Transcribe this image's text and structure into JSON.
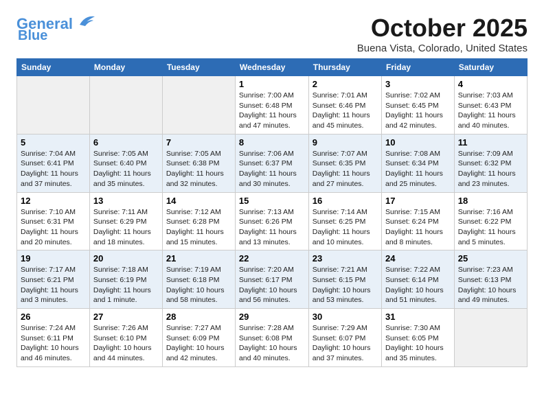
{
  "header": {
    "logo_line1": "General",
    "logo_line2": "Blue",
    "month": "October 2025",
    "location": "Buena Vista, Colorado, United States"
  },
  "weekdays": [
    "Sunday",
    "Monday",
    "Tuesday",
    "Wednesday",
    "Thursday",
    "Friday",
    "Saturday"
  ],
  "weeks": [
    [
      {
        "num": "",
        "info": ""
      },
      {
        "num": "",
        "info": ""
      },
      {
        "num": "",
        "info": ""
      },
      {
        "num": "1",
        "info": "Sunrise: 7:00 AM\nSunset: 6:48 PM\nDaylight: 11 hours\nand 47 minutes."
      },
      {
        "num": "2",
        "info": "Sunrise: 7:01 AM\nSunset: 6:46 PM\nDaylight: 11 hours\nand 45 minutes."
      },
      {
        "num": "3",
        "info": "Sunrise: 7:02 AM\nSunset: 6:45 PM\nDaylight: 11 hours\nand 42 minutes."
      },
      {
        "num": "4",
        "info": "Sunrise: 7:03 AM\nSunset: 6:43 PM\nDaylight: 11 hours\nand 40 minutes."
      }
    ],
    [
      {
        "num": "5",
        "info": "Sunrise: 7:04 AM\nSunset: 6:41 PM\nDaylight: 11 hours\nand 37 minutes."
      },
      {
        "num": "6",
        "info": "Sunrise: 7:05 AM\nSunset: 6:40 PM\nDaylight: 11 hours\nand 35 minutes."
      },
      {
        "num": "7",
        "info": "Sunrise: 7:05 AM\nSunset: 6:38 PM\nDaylight: 11 hours\nand 32 minutes."
      },
      {
        "num": "8",
        "info": "Sunrise: 7:06 AM\nSunset: 6:37 PM\nDaylight: 11 hours\nand 30 minutes."
      },
      {
        "num": "9",
        "info": "Sunrise: 7:07 AM\nSunset: 6:35 PM\nDaylight: 11 hours\nand 27 minutes."
      },
      {
        "num": "10",
        "info": "Sunrise: 7:08 AM\nSunset: 6:34 PM\nDaylight: 11 hours\nand 25 minutes."
      },
      {
        "num": "11",
        "info": "Sunrise: 7:09 AM\nSunset: 6:32 PM\nDaylight: 11 hours\nand 23 minutes."
      }
    ],
    [
      {
        "num": "12",
        "info": "Sunrise: 7:10 AM\nSunset: 6:31 PM\nDaylight: 11 hours\nand 20 minutes."
      },
      {
        "num": "13",
        "info": "Sunrise: 7:11 AM\nSunset: 6:29 PM\nDaylight: 11 hours\nand 18 minutes."
      },
      {
        "num": "14",
        "info": "Sunrise: 7:12 AM\nSunset: 6:28 PM\nDaylight: 11 hours\nand 15 minutes."
      },
      {
        "num": "15",
        "info": "Sunrise: 7:13 AM\nSunset: 6:26 PM\nDaylight: 11 hours\nand 13 minutes."
      },
      {
        "num": "16",
        "info": "Sunrise: 7:14 AM\nSunset: 6:25 PM\nDaylight: 11 hours\nand 10 minutes."
      },
      {
        "num": "17",
        "info": "Sunrise: 7:15 AM\nSunset: 6:24 PM\nDaylight: 11 hours\nand 8 minutes."
      },
      {
        "num": "18",
        "info": "Sunrise: 7:16 AM\nSunset: 6:22 PM\nDaylight: 11 hours\nand 5 minutes."
      }
    ],
    [
      {
        "num": "19",
        "info": "Sunrise: 7:17 AM\nSunset: 6:21 PM\nDaylight: 11 hours\nand 3 minutes."
      },
      {
        "num": "20",
        "info": "Sunrise: 7:18 AM\nSunset: 6:19 PM\nDaylight: 11 hours\nand 1 minute."
      },
      {
        "num": "21",
        "info": "Sunrise: 7:19 AM\nSunset: 6:18 PM\nDaylight: 10 hours\nand 58 minutes."
      },
      {
        "num": "22",
        "info": "Sunrise: 7:20 AM\nSunset: 6:17 PM\nDaylight: 10 hours\nand 56 minutes."
      },
      {
        "num": "23",
        "info": "Sunrise: 7:21 AM\nSunset: 6:15 PM\nDaylight: 10 hours\nand 53 minutes."
      },
      {
        "num": "24",
        "info": "Sunrise: 7:22 AM\nSunset: 6:14 PM\nDaylight: 10 hours\nand 51 minutes."
      },
      {
        "num": "25",
        "info": "Sunrise: 7:23 AM\nSunset: 6:13 PM\nDaylight: 10 hours\nand 49 minutes."
      }
    ],
    [
      {
        "num": "26",
        "info": "Sunrise: 7:24 AM\nSunset: 6:11 PM\nDaylight: 10 hours\nand 46 minutes."
      },
      {
        "num": "27",
        "info": "Sunrise: 7:26 AM\nSunset: 6:10 PM\nDaylight: 10 hours\nand 44 minutes."
      },
      {
        "num": "28",
        "info": "Sunrise: 7:27 AM\nSunset: 6:09 PM\nDaylight: 10 hours\nand 42 minutes."
      },
      {
        "num": "29",
        "info": "Sunrise: 7:28 AM\nSunset: 6:08 PM\nDaylight: 10 hours\nand 40 minutes."
      },
      {
        "num": "30",
        "info": "Sunrise: 7:29 AM\nSunset: 6:07 PM\nDaylight: 10 hours\nand 37 minutes."
      },
      {
        "num": "31",
        "info": "Sunrise: 7:30 AM\nSunset: 6:05 PM\nDaylight: 10 hours\nand 35 minutes."
      },
      {
        "num": "",
        "info": ""
      }
    ]
  ]
}
